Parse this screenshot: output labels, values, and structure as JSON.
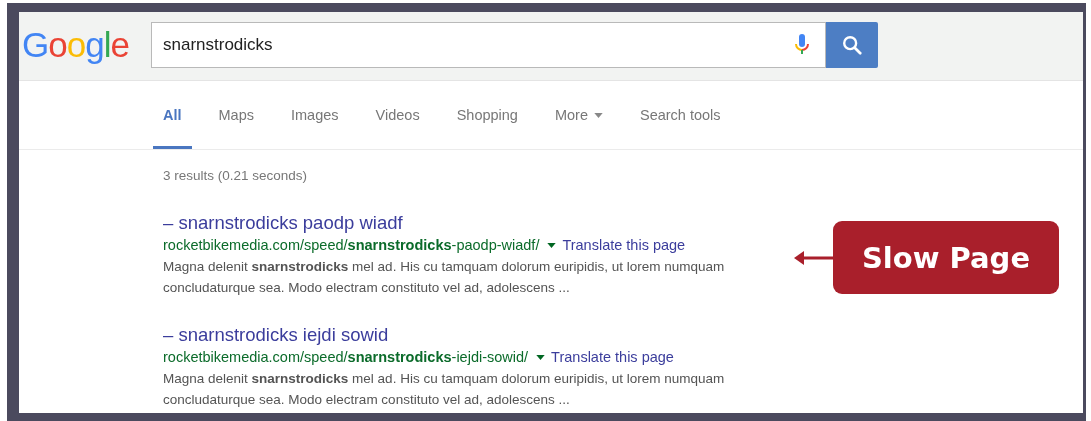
{
  "search": {
    "logo": "Google",
    "query": "snarnstrodicks"
  },
  "tabs": [
    {
      "label": "All",
      "selected": true,
      "kind": "tab"
    },
    {
      "label": "Maps",
      "selected": false,
      "kind": "tab"
    },
    {
      "label": "Images",
      "selected": false,
      "kind": "tab"
    },
    {
      "label": "Videos",
      "selected": false,
      "kind": "tab"
    },
    {
      "label": "Shopping",
      "selected": false,
      "kind": "tab"
    },
    {
      "label": "More",
      "selected": false,
      "kind": "menu"
    },
    {
      "label": "Search tools",
      "selected": false,
      "kind": "tool"
    }
  ],
  "result_stats": "3 results (0.21 seconds)",
  "results": [
    {
      "title": "– snarnstrodicks paodp wiadf",
      "url": "rocketbikemedia.com/speed/**snarnstrodicks**-paodp-wiadf/",
      "translate": "Translate this page",
      "snippet": "Magna delenit **snarnstrodicks** mel ad. His cu tamquam dolorum euripidis, ut lorem numquam concludaturque sea. Modo electram constituto vel ad, adolescens ..."
    },
    {
      "title": "– snarnstrodicks iejdi sowid",
      "url": "rocketbikemedia.com/speed/**snarnstrodicks**-iejdi-sowid/",
      "translate": "Translate this page",
      "snippet": "Magna delenit **snarnstrodicks** mel ad. His cu tamquam dolorum euripidis, ut lorem numquam concludaturque sea. Modo electram constituto vel ad, adolescens ..."
    }
  ],
  "callout": {
    "text": "Slow Page"
  }
}
